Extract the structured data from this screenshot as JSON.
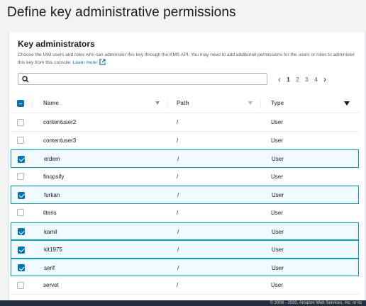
{
  "page": {
    "title": "Define key administrative permissions"
  },
  "panel": {
    "title": "Key administrators",
    "description": "Choose the IAM users and roles who can administer this key through the KMS API. You may need to add additional permissions for the users or roles to administer this key from this console.",
    "learn_more": "Learn more"
  },
  "search": {
    "value": "",
    "placeholder": ""
  },
  "pagination": {
    "prev": "‹",
    "pages": [
      "1",
      "2",
      "3",
      "4"
    ],
    "current": "1",
    "next": "›"
  },
  "table": {
    "columns": {
      "name": "Name",
      "path": "Path",
      "type": "Type"
    },
    "rows": [
      {
        "name": "contentuser2",
        "path": "/",
        "type": "User",
        "checked": false
      },
      {
        "name": "contentuser3",
        "path": "/",
        "type": "User",
        "checked": false
      },
      {
        "name": "erdem",
        "path": "/",
        "type": "User",
        "checked": true
      },
      {
        "name": "finopsify",
        "path": "/",
        "type": "User",
        "checked": false
      },
      {
        "name": "furkan",
        "path": "/",
        "type": "User",
        "checked": true
      },
      {
        "name": "ilteris",
        "path": "/",
        "type": "User",
        "checked": false
      },
      {
        "name": "kamil",
        "path": "/",
        "type": "User",
        "checked": true
      },
      {
        "name": "kit1975",
        "path": "/",
        "type": "User",
        "checked": true
      },
      {
        "name": "serif",
        "path": "/",
        "type": "User",
        "checked": true
      },
      {
        "name": "servet",
        "path": "/",
        "type": "User",
        "checked": false
      }
    ]
  },
  "footer": {
    "text": "© 2008 - 2020, Amazon Web Services, Inc. or its"
  },
  "colors": {
    "accent": "#0073bb",
    "selected_border": "#00a1c9",
    "selected_bg": "#f1faff"
  }
}
